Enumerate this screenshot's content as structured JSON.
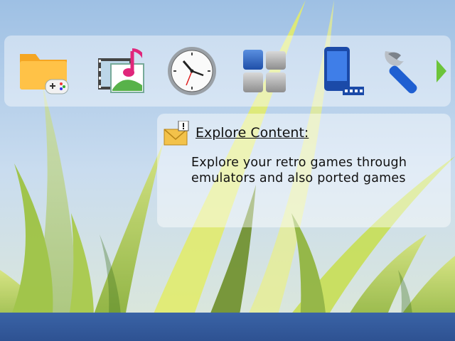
{
  "background": {
    "name": "grass-wallpaper",
    "sky_color": "#b8d2ec",
    "grass_color": "#b6d24a"
  },
  "icon_bar": {
    "items": [
      {
        "name": "games-folder-icon"
      },
      {
        "name": "media-icon"
      },
      {
        "name": "clock-icon"
      },
      {
        "name": "applications-grid-icon"
      },
      {
        "name": "device-icon"
      },
      {
        "name": "settings-wrench-icon"
      }
    ],
    "scroll_arrow": "next-arrow-icon"
  },
  "info_panel": {
    "icon": "message-envelope-icon",
    "title": "Explore Content:",
    "description": "Explore your retro games through emulators and also ported games"
  },
  "colors": {
    "bottom_bar": "#3560a3",
    "accent_green": "#6cc43a"
  }
}
